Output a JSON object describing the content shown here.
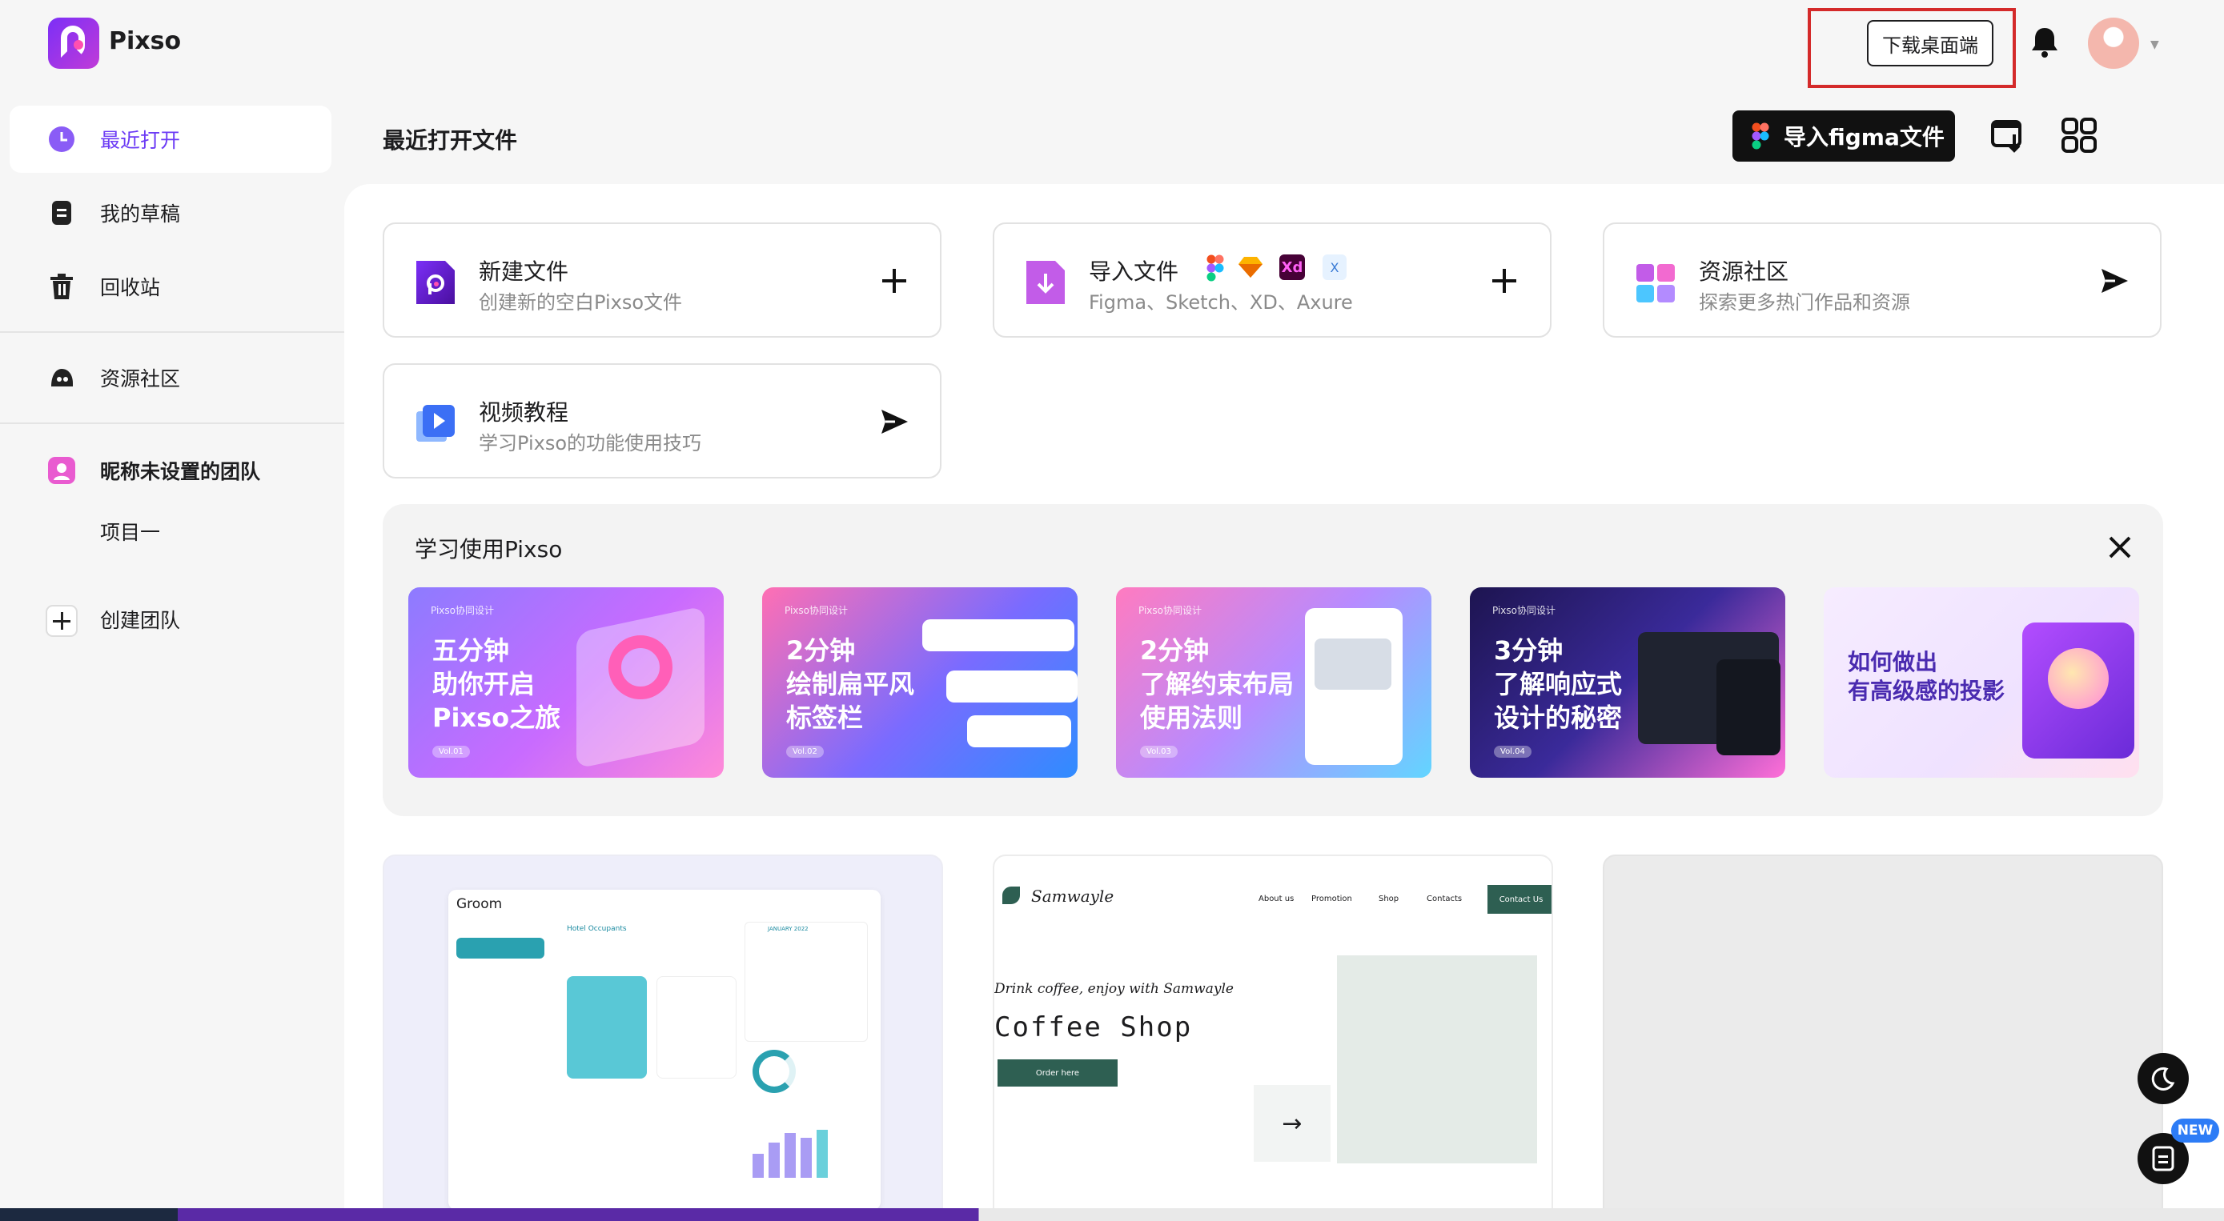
{
  "app": {
    "name": "Pixso"
  },
  "header": {
    "download_label": "下载桌面端"
  },
  "sidebar": {
    "items": [
      {
        "label": "最近打开",
        "icon": "clock-icon"
      },
      {
        "label": "我的草稿",
        "icon": "draft-icon"
      },
      {
        "label": "回收站",
        "icon": "trash-icon"
      },
      {
        "label": "资源社区",
        "icon": "community-icon"
      }
    ],
    "team": {
      "name": "昵称未设置的团队",
      "project": "项目一"
    },
    "create_team": "创建团队"
  },
  "main": {
    "title": "最近打开文件",
    "import_figma_label": "导入figma文件"
  },
  "cards": [
    {
      "title": "新建文件",
      "subtitle": "创建新的空白Pixso文件",
      "action": "plus-icon"
    },
    {
      "title": "导入文件",
      "subtitle": "Figma、Sketch、XD、Axure",
      "action": "plus-icon"
    },
    {
      "title": "资源社区",
      "subtitle": "探索更多热门作品和资源",
      "action": "send-icon"
    },
    {
      "title": "视频教程",
      "subtitle": "学习Pixso的功能使用技巧",
      "action": "send-icon"
    }
  ],
  "learn": {
    "title": "学习使用Pixso",
    "tutorials": [
      {
        "brand": "Pixso协同设计",
        "title": "五分钟\n助你开启\nPixso之旅",
        "vol": "Vol.01"
      },
      {
        "brand": "Pixso协同设计",
        "title": "2分钟\n绘制扁平风\n标签栏",
        "vol": "Vol.02"
      },
      {
        "brand": "Pixso协同设计",
        "title": "2分钟\n了解约束布局\n使用法则",
        "vol": "Vol.03"
      },
      {
        "brand": "Pixso协同设计",
        "title": "3分钟\n了解响应式\n设计的秘密",
        "vol": "Vol.04"
      },
      {
        "brand": "",
        "title": "如何做出\n有高级感的投影",
        "vol": ""
      }
    ]
  },
  "files": [
    {
      "app_name": "Groom",
      "heading": "Hotel Occupants",
      "month": "JANUARY 2022"
    },
    {
      "brand": "Samwayle",
      "nav": [
        "About us",
        "Promotion",
        "Shop",
        "Contacts"
      ],
      "cta": "Contact Us",
      "tagline": "Drink coffee, enjoy with Samwayle",
      "headline": "Coffee Shop",
      "button": "Order here",
      "arrow": "→"
    },
    {}
  ],
  "floating": {
    "new_badge": "NEW"
  },
  "colors": {
    "accent": "#6c3bf5",
    "highlight": "#d42a2a",
    "dark": "#111111"
  }
}
